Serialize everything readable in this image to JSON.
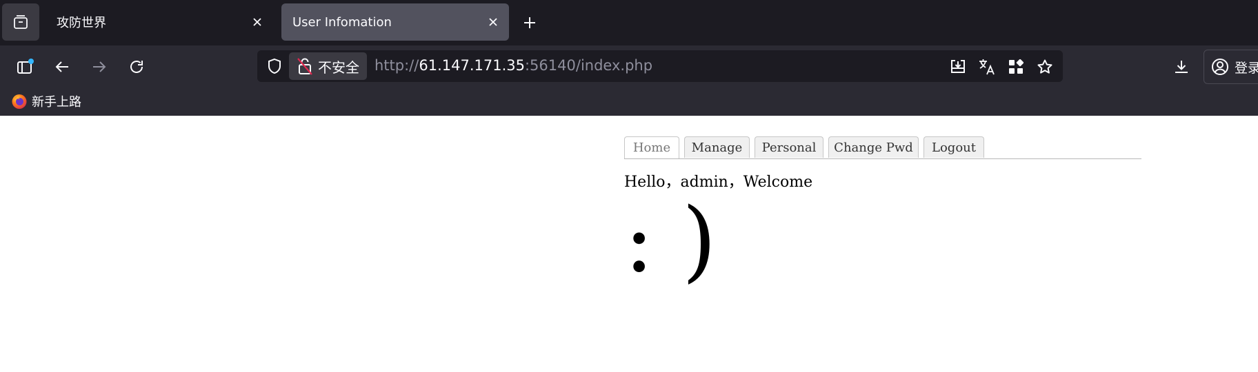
{
  "browser": {
    "tabs": [
      {
        "title": "攻防世界",
        "active": false
      },
      {
        "title": "User Infomation",
        "active": true
      }
    ],
    "address_bar": {
      "security_label": "不安全",
      "url_scheme": "http://",
      "url_host": "61.147.171.35",
      "url_rest": ":56140/index.php"
    },
    "account_label": "登录",
    "bookmarks": [
      {
        "label": "新手上路",
        "icon": "firefox-icon"
      }
    ],
    "colors": {
      "tabbar_bg": "#1c1b22",
      "toolbar_bg": "#2b2a33",
      "active_tab_bg": "#52525e",
      "text": "#fbfbfe",
      "url_dim": "#8f8f9d"
    }
  },
  "page": {
    "nav_tabs": [
      {
        "label": "Home",
        "active": true
      },
      {
        "label": "Manage",
        "active": false
      },
      {
        "label": "Personal",
        "active": false
      },
      {
        "label": "Change Pwd",
        "active": false
      },
      {
        "label": "Logout",
        "active": false
      }
    ],
    "greeting": "Hello，admin，Welcome",
    "emoticon": ": )"
  }
}
